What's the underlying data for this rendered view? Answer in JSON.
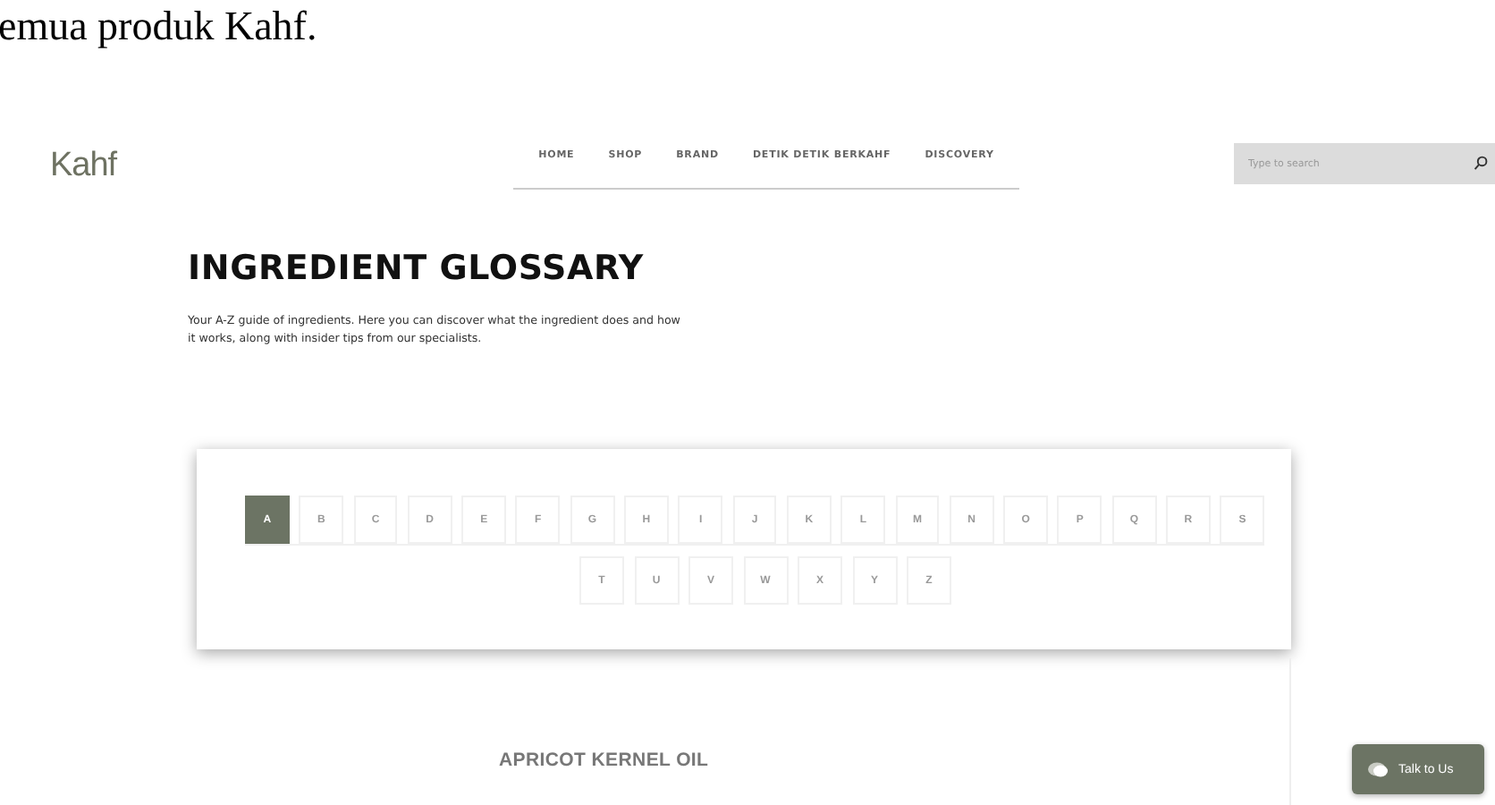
{
  "document_text": "emua produk Kahf.",
  "header": {
    "logo": "Kahf",
    "nav": [
      "HOME",
      "SHOP",
      "BRAND",
      "DETIK DETIK BERKAHF",
      "DISCOVERY"
    ],
    "search": {
      "placeholder": "Type to search"
    }
  },
  "glossary": {
    "title": "INGREDIENT GLOSSARY",
    "description": "Your A-Z guide of ingredients. Here you can discover what the ingredient does and how it works, along with insider tips from our specialists.",
    "letters": [
      {
        "label": "A",
        "selected": true
      },
      {
        "label": "B",
        "selected": false
      },
      {
        "label": "C",
        "selected": false
      },
      {
        "label": "D",
        "selected": false
      },
      {
        "label": "E",
        "selected": false
      },
      {
        "label": "F",
        "selected": false
      },
      {
        "label": "G",
        "selected": false
      },
      {
        "label": "H",
        "selected": false
      },
      {
        "label": "I",
        "selected": false
      },
      {
        "label": "J",
        "selected": false
      },
      {
        "label": "K",
        "selected": false
      },
      {
        "label": "L",
        "selected": false
      },
      {
        "label": "M",
        "selected": false
      },
      {
        "label": "N",
        "selected": false
      },
      {
        "label": "O",
        "selected": false
      },
      {
        "label": "P",
        "selected": false
      },
      {
        "label": "Q",
        "selected": false
      },
      {
        "label": "R",
        "selected": false
      },
      {
        "label": "S",
        "selected": false
      },
      {
        "label": "T",
        "selected": false
      },
      {
        "label": "U",
        "selected": false
      },
      {
        "label": "V",
        "selected": false
      },
      {
        "label": "W",
        "selected": false
      },
      {
        "label": "X",
        "selected": false
      },
      {
        "label": "Y",
        "selected": false
      },
      {
        "label": "Z",
        "selected": false
      }
    ]
  },
  "entry": {
    "title": "APRICOT KERNEL OIL"
  },
  "chat_button": {
    "label": "Talk to Us"
  }
}
